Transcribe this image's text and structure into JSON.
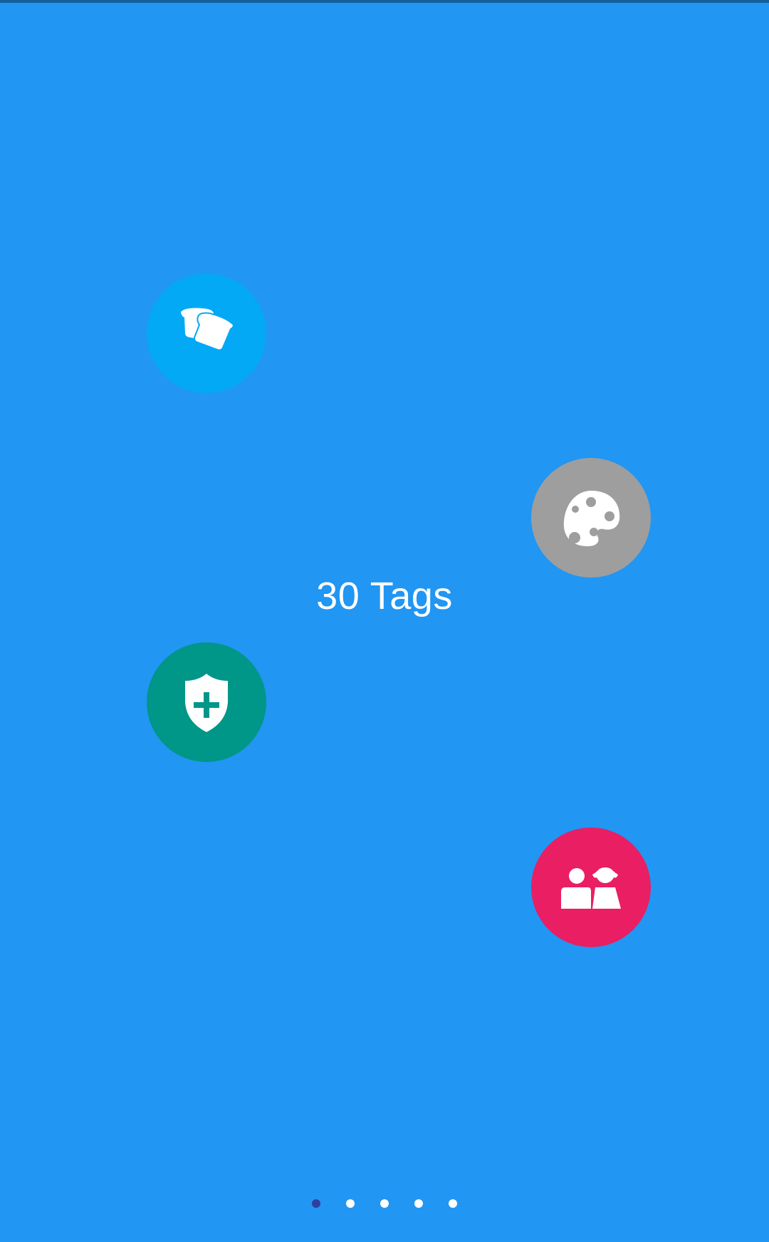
{
  "title": "30 Tags",
  "tags": [
    {
      "icon": "bread-icon",
      "color": "#03a9f4"
    },
    {
      "icon": "palette-icon",
      "color": "#9e9e9e"
    },
    {
      "icon": "health-shield-icon",
      "color": "#009688"
    },
    {
      "icon": "family-icon",
      "color": "#e91e63"
    }
  ],
  "pager": {
    "count": 5,
    "active_index": 0,
    "active_color": "#303f9f"
  }
}
